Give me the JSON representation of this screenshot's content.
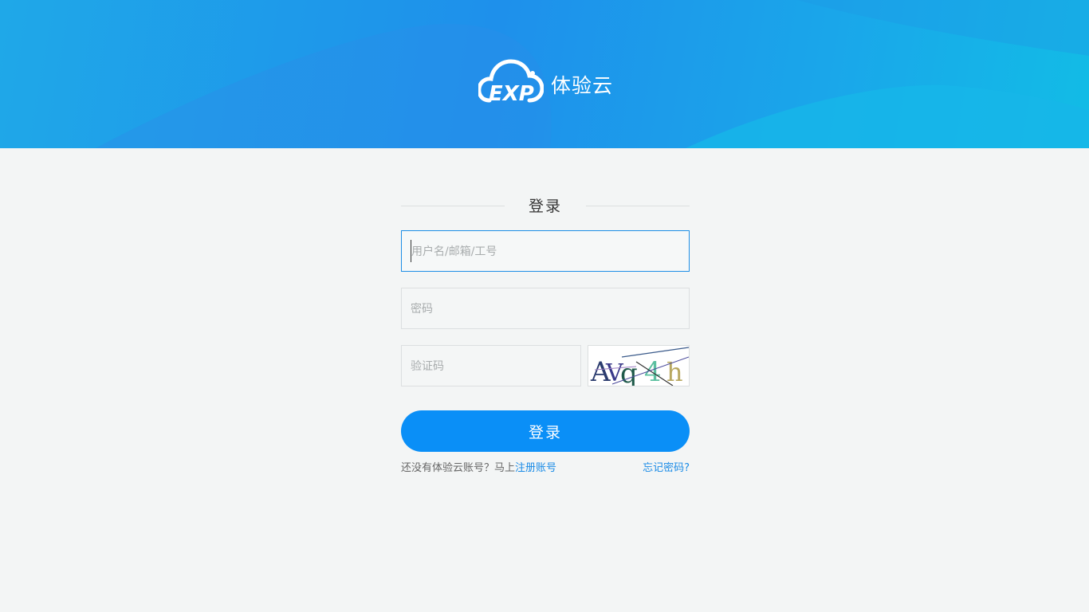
{
  "header": {
    "brand": "体验云",
    "logo_letters": "EXP",
    "colors": {
      "gradient_start": "#1fa8e8",
      "gradient_mid": "#1e90eb",
      "gradient_end": "#12bce6"
    }
  },
  "form": {
    "title": "登录",
    "username": {
      "placeholder": "用户名/邮箱/工号",
      "value": ""
    },
    "password": {
      "placeholder": "密码",
      "value": ""
    },
    "captcha": {
      "placeholder": "验证码",
      "value": "",
      "image_text": "AVq4h"
    },
    "submit_label": "登录",
    "register_prompt": "还没有体验云账号？马上",
    "register_link": "注册账号",
    "forgot_link": "忘记密码?"
  },
  "colors": {
    "accent": "#0a8ff7",
    "link": "#1a8be6",
    "background": "#f3f5f5"
  }
}
